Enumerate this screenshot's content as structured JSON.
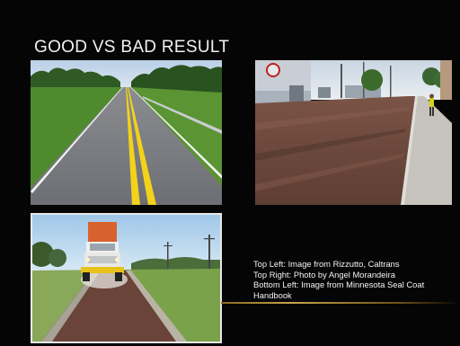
{
  "slide": {
    "title": "GOOD VS BAD RESULT",
    "credits": [
      "Top Left: Image from Rizzutto, Caltrans",
      "Top Right: Photo by Angel Morandeira",
      "Bottom Left: Image from Minnesota Seal Coat Handbook"
    ]
  },
  "images": [
    {
      "name": "good-road-photo"
    },
    {
      "name": "bad-road-photo"
    },
    {
      "name": "seal-coat-truck-photo"
    }
  ],
  "colors": {
    "background": "#050505",
    "title_text": "#f2f2f2",
    "accent": "#c9a44a"
  }
}
